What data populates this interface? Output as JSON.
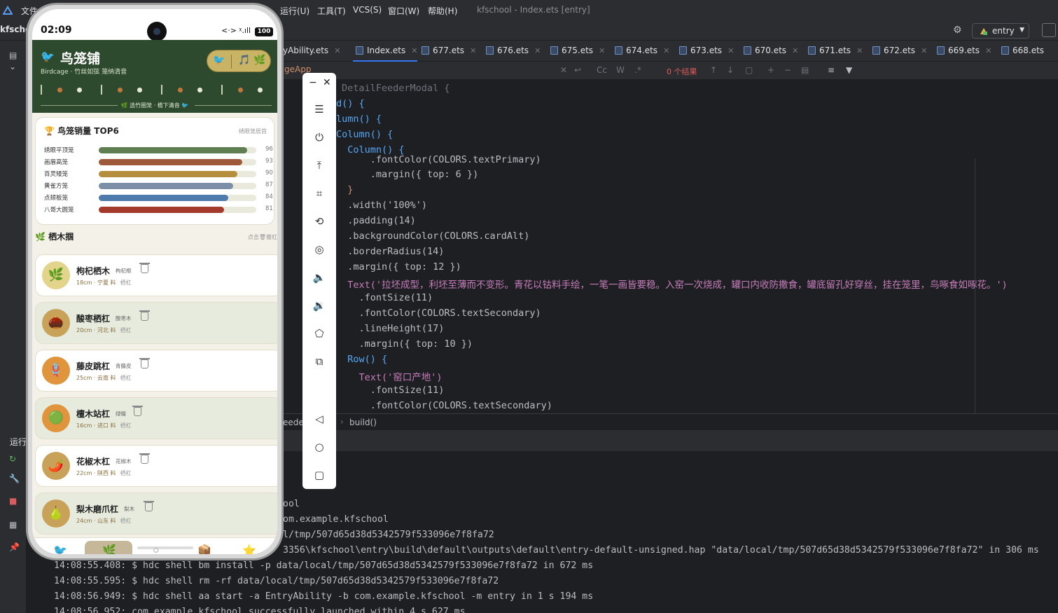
{
  "ide": {
    "menus": [
      "文件",
      "运行(U)",
      "工具(T)",
      "VCS(S)",
      "窗口(W)",
      "帮助(H)"
    ],
    "window_title": "kfschool - Index.ets [entry]",
    "project": "kfschc",
    "run_config": "entry",
    "tabs": [
      {
        "label": "yAbility.ets",
        "active": false
      },
      {
        "label": "Index.ets",
        "active": true
      },
      {
        "label": "677.ets",
        "active": false
      },
      {
        "label": "676.ets",
        "active": false
      },
      {
        "label": "675.ets",
        "active": false
      },
      {
        "label": "674.ets",
        "active": false
      },
      {
        "label": "673.ets",
        "active": false
      },
      {
        "label": "670.ets",
        "active": false
      },
      {
        "label": "671.ets",
        "active": false
      },
      {
        "label": "672.ets",
        "active": false
      },
      {
        "label": "669.ets",
        "active": false
      },
      {
        "label": "668.ets",
        "active": false
      }
    ],
    "search_text": "geApp",
    "find_result": "0 个结果",
    "breadcrumb_left": "eede",
    "breadcrumb": "build()",
    "run_label": "运行",
    "code_lines": [
      "DetailFeederModal {",
      "d() {",
      "lumn() {",
      "Column() {",
      "  Column() {",
      "      .fontColor(COLORS.textPrimary)",
      "      .margin({ top: 6 })",
      "  }",
      "  .width('100%')",
      "  .padding(14)",
      "  .backgroundColor(COLORS.cardAlt)",
      "  .borderRadius(14)",
      "  .margin({ top: 12 })",
      "  Text('拉坯成型，利坯至薄而不变形。青花以钴料手绘，一笔一画皆要稳。入窑一次烧成，罐口内收防撒食，罐底留孔好穿丝，挂在笼里，鸟啄食如啄花。')",
      "    .fontSize(11)",
      "    .fontColor(COLORS.textSecondary)",
      "    .lineHeight(17)",
      "    .margin({ top: 10 })",
      "  Row() {",
      "    Text('窑口产地')",
      "      .fontSize(11)",
      "      .fontColor(COLORS.textSecondary)"
    ],
    "console_lines": [
      "ool",
      "om.example.kfschool",
      "l/tmp/507d65d38d5342579f533096e7f8fa72",
      "3356\\kfschool\\entry\\build\\default\\outputs\\default\\entry-default-unsigned.hap \"data/local/tmp/507d65d38d5342579f533096e7f8fa72\" in 306 ms",
      "14:08:55.408: $ hdc shell bm install -p data/local/tmp/507d65d38d5342579f533096e7f8fa72 in 672 ms",
      "14:08:55.595: $ hdc shell rm -rf data/local/tmp/507d65d38d5342579f533096e7f8fa72",
      "14:08:56.949: $ hdc shell aa start -a EntryAbility -b com.example.kfschool -m entry in 1 s 194 ms",
      "14:08:56.952: com.example.kfschool successfully launched within 4 s 627 ms"
    ]
  },
  "phone": {
    "status": {
      "time": "02:09",
      "signal": "<·> ᵡ.ıll",
      "battery": "100"
    },
    "header": {
      "title": "鸟笼铺",
      "subtitle": "Birdcage · 竹丝如弦 笼纳清音",
      "footer": "🌿 选竹圈笼 · 檐下清音 🐦",
      "pill_icons": [
        "🐦",
        "🎵",
        "🌿"
      ]
    },
    "ranking": {
      "title": "鸟笼销量 TOP6",
      "subtitle": "绣眼笼居首",
      "items": [
        {
          "name": "绣眼平顶笼",
          "value": 96,
          "color": "#5f7f52"
        },
        {
          "name": "画眉高笼",
          "value": 93,
          "color": "#a0583a"
        },
        {
          "name": "百灵矮笼",
          "value": 90,
          "color": "#b58f3d"
        },
        {
          "name": "黄雀方笼",
          "value": 87,
          "color": "#7d8fa8"
        },
        {
          "name": "点颏板笼",
          "value": 84,
          "color": "#4f7aac"
        },
        {
          "name": "八哥大圆笼",
          "value": 81,
          "color": "#a33a2c"
        }
      ]
    },
    "perches": {
      "title": "栖木掴",
      "hint": "点击🗑撤杠",
      "items": [
        {
          "name": "枸杞栖木",
          "tag": "枸杞根",
          "meta": "18cm · 宁夏 料",
          "perch": "栖杠",
          "icon": "🌿",
          "icon_bg": "#e2d48a",
          "bg": "#ffffff"
        },
        {
          "name": "酸枣栖杠",
          "tag": "酸枣木",
          "meta": "20cm · 河北 料",
          "perch": "栖杠",
          "icon": "🌰",
          "icon_bg": "#c9a25a",
          "bg": "#e6ebdd"
        },
        {
          "name": "藤皮跳杠",
          "tag": "青藤皮",
          "meta": "25cm · 云南 料",
          "perch": "栖杠",
          "icon": "🪢",
          "icon_bg": "#e0953d",
          "bg": "#ffffff"
        },
        {
          "name": "檀木站杠",
          "tag": "绿檀",
          "meta": "16cm · 进口 料",
          "perch": "栖杠",
          "icon": "🟢",
          "icon_bg": "#e0953d",
          "bg": "#e6ebdd"
        },
        {
          "name": "花椒木杠",
          "tag": "花椒木",
          "meta": "22cm · 陕西 料",
          "perch": "栖杠",
          "icon": "🌶️",
          "icon_bg": "#c9a25a",
          "bg": "#ffffff"
        },
        {
          "name": "梨木磨爪杠",
          "tag": "梨木",
          "meta": "24cm · 山东 料",
          "perch": "栖杠",
          "icon": "🍐",
          "icon_bg": "#c9a25a",
          "bg": "#e6ebdd"
        }
      ]
    },
    "nav_icons": [
      "🐦",
      "🌿",
      "⚪",
      "📦",
      "⭐"
    ]
  }
}
